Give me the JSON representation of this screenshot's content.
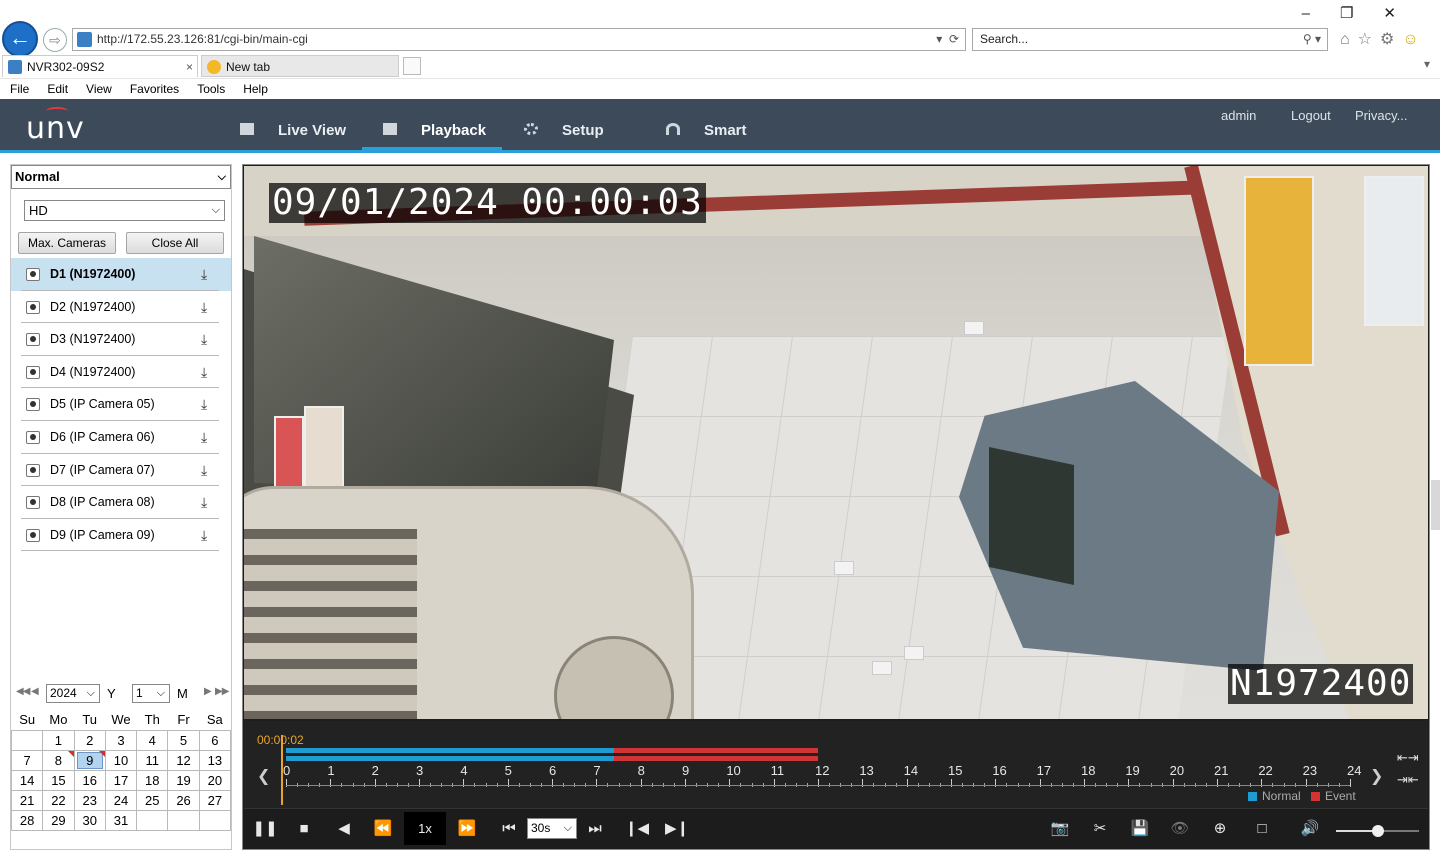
{
  "browser": {
    "address_prefix": "http://172.55.23.126:81/cgi-bin/main-cgi",
    "search_placeholder": "Search...",
    "tabs": [
      {
        "label": "NVR302-09S2",
        "active": true
      },
      {
        "label": "New tab",
        "active": false
      }
    ],
    "menu": [
      "File",
      "Edit",
      "View",
      "Favorites",
      "Tools",
      "Help"
    ]
  },
  "app": {
    "logo": "unv",
    "nav": [
      {
        "label": "Live View",
        "icon": "monitor-icon"
      },
      {
        "label": "Playback",
        "icon": "film-icon",
        "active": true
      },
      {
        "label": "Setup",
        "icon": "gear-icon"
      },
      {
        "label": "Smart",
        "icon": "person-search-icon"
      }
    ],
    "user": "admin",
    "logout": "Logout",
    "privacy": "Privacy...",
    "accent": "#2aa0d8",
    "header_bg": "#3c4a5a"
  },
  "left_panel": {
    "mode_select": "Normal",
    "stream_select": "HD",
    "max_cameras_label": "Max. Cameras",
    "close_all_label": "Close All",
    "cameras": [
      {
        "label": "D1 (N1972400)",
        "selected": true
      },
      {
        "label": "D2 (N1972400)",
        "selected": false
      },
      {
        "label": "D3 (N1972400)",
        "selected": false
      },
      {
        "label": "D4 (N1972400)",
        "selected": false
      },
      {
        "label": "D5 (IP Camera 05)",
        "selected": false
      },
      {
        "label": "D6 (IP Camera 06)",
        "selected": false
      },
      {
        "label": "D7 (IP Camera 07)",
        "selected": false
      },
      {
        "label": "D8 (IP Camera 08)",
        "selected": false
      },
      {
        "label": "D9 (IP Camera 09)",
        "selected": false
      }
    ]
  },
  "calendar": {
    "year": "2024",
    "year_label": "Y",
    "month": "1",
    "month_label": "M",
    "weekdays": [
      "Su",
      "Mo",
      "Tu",
      "We",
      "Th",
      "Fr",
      "Sa"
    ],
    "weeks": [
      [
        "",
        "1",
        "2",
        "3",
        "4",
        "5",
        "6"
      ],
      [
        "7",
        "8",
        "9",
        "10",
        "11",
        "12",
        "13"
      ],
      [
        "14",
        "15",
        "16",
        "17",
        "18",
        "19",
        "20"
      ],
      [
        "21",
        "22",
        "23",
        "24",
        "25",
        "26",
        "27"
      ],
      [
        "28",
        "29",
        "30",
        "31",
        "",
        "",
        ""
      ]
    ],
    "selected_day": "9"
  },
  "video": {
    "osd_time": "09/01/2024 00:00:03",
    "osd_name": "N1972400"
  },
  "timeline": {
    "current_time": "00:00:02",
    "hour_labels": [
      "0",
      "1",
      "2",
      "3",
      "4",
      "5",
      "6",
      "7",
      "8",
      "9",
      "10",
      "11",
      "12",
      "13",
      "14",
      "15",
      "16",
      "17",
      "18",
      "19",
      "20",
      "21",
      "22",
      "23",
      "24"
    ],
    "normal_color": "#1e9bd1",
    "event_color": "#d13434",
    "legend_normal": "Normal",
    "legend_event": "Event",
    "normal_range_hours": [
      0,
      7.4
    ],
    "event_range_hours": [
      7.4,
      12
    ]
  },
  "controls": {
    "speed": "1x",
    "step": "30s",
    "volume": 0.5
  }
}
